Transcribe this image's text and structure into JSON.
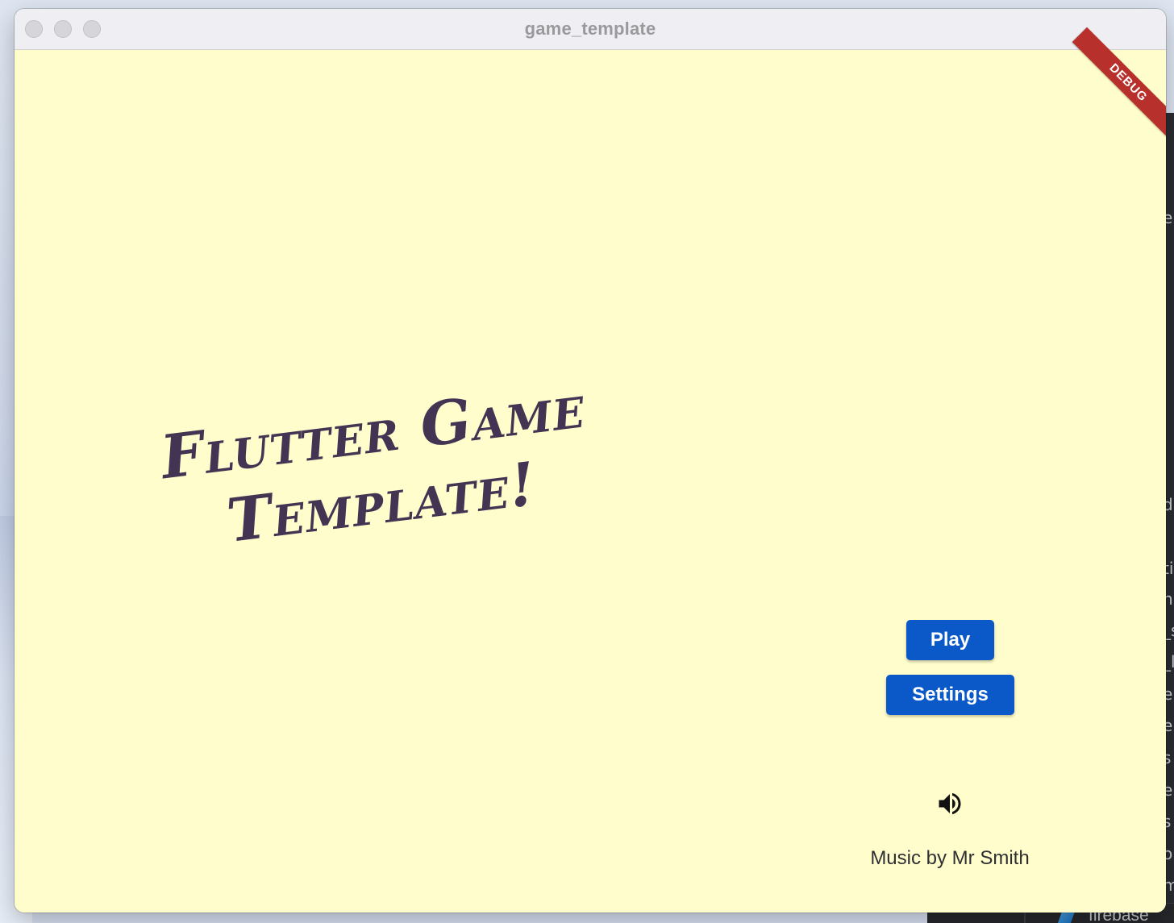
{
  "window": {
    "title": "game_template"
  },
  "debug_banner": {
    "label": "DEBUG",
    "color": "#b8302c"
  },
  "menu": {
    "title_line1": "Flutter Game",
    "title_line2": "Template!",
    "play_label": "Play",
    "settings_label": "Settings",
    "sound_icon": "volume-up-icon",
    "music_credit": "Music by Mr Smith"
  },
  "background": {
    "bottom_bar_label": "firebase",
    "right_edge_letters": [
      "e",
      "d",
      "ti",
      "n",
      "_s",
      "_l",
      "el",
      "e",
      "s",
      "e",
      "s",
      "o",
      "m"
    ]
  },
  "colors": {
    "content_background": "#fffdcb",
    "button": "#0b58c9",
    "title_text": "#423452"
  }
}
